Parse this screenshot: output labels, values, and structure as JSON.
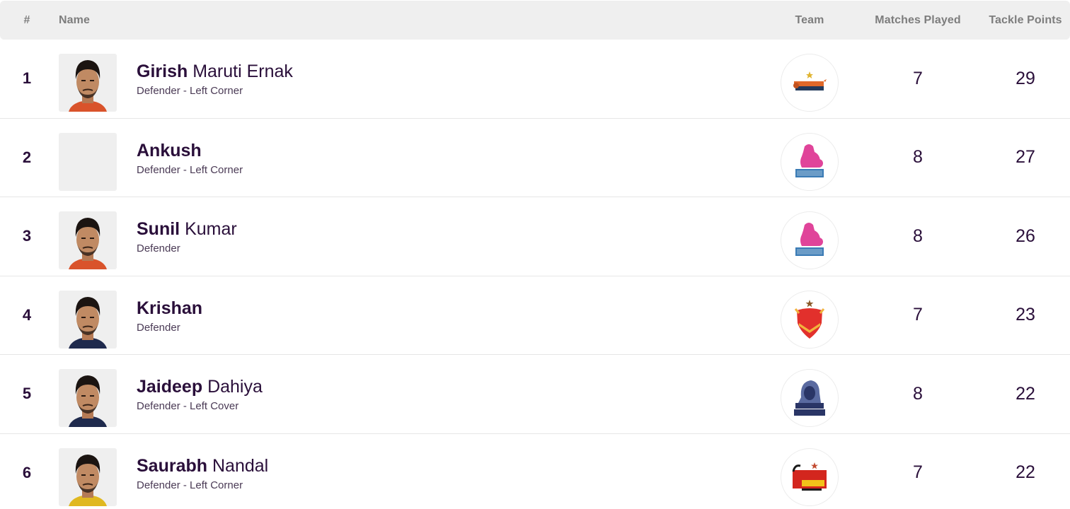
{
  "table": {
    "headers": {
      "rank": "#",
      "name": "Name",
      "team": "Team",
      "matches_played": "Matches Played",
      "tackle_points": "Tackle Points"
    },
    "rows": [
      {
        "rank": "1",
        "first_name": "Girish",
        "last_name": "Maruti Ernak",
        "position": "Defender - Left Corner",
        "team": "Bengal Warriors",
        "team_logo": "bengal-warriors-logo",
        "has_photo": true,
        "jersey_color": "#d9532b",
        "matches_played": "7",
        "tackle_points": "29"
      },
      {
        "rank": "2",
        "first_name": "Ankush",
        "last_name": "",
        "position": "Defender - Left Corner",
        "team": "Jaipur Pink Panthers",
        "team_logo": "jaipur-pink-panthers-logo",
        "has_photo": false,
        "jersey_color": "",
        "matches_played": "8",
        "tackle_points": "27"
      },
      {
        "rank": "3",
        "first_name": "Sunil",
        "last_name": "Kumar",
        "position": "Defender",
        "team": "Jaipur Pink Panthers",
        "team_logo": "jaipur-pink-panthers-logo",
        "has_photo": true,
        "jersey_color": "#d9532b",
        "matches_played": "8",
        "tackle_points": "26"
      },
      {
        "rank": "4",
        "first_name": "Krishan",
        "last_name": "",
        "position": "Defender",
        "team": "Dabang Delhi K.C.",
        "team_logo": "dabang-delhi-logo",
        "has_photo": true,
        "jersey_color": "#1f2a4d",
        "matches_played": "7",
        "tackle_points": "23"
      },
      {
        "rank": "5",
        "first_name": "Jaideep",
        "last_name": "Dahiya",
        "position": "Defender - Left Cover",
        "team": "Haryana Steelers",
        "team_logo": "haryana-steelers-logo",
        "has_photo": true,
        "jersey_color": "#1f2a4d",
        "matches_played": "8",
        "tackle_points": "22"
      },
      {
        "rank": "6",
        "first_name": "Saurabh",
        "last_name": "Nandal",
        "position": "Defender - Left Corner",
        "team": "Bengaluru Bulls",
        "team_logo": "bengaluru-bulls-logo",
        "has_photo": true,
        "jersey_color": "#e0b820",
        "matches_played": "7",
        "tackle_points": "22"
      }
    ]
  },
  "colors": {
    "header_bg": "#efefef",
    "header_text": "#7d7d7d",
    "primary_text": "#2a0f3a",
    "divider": "#e6e6e6"
  }
}
